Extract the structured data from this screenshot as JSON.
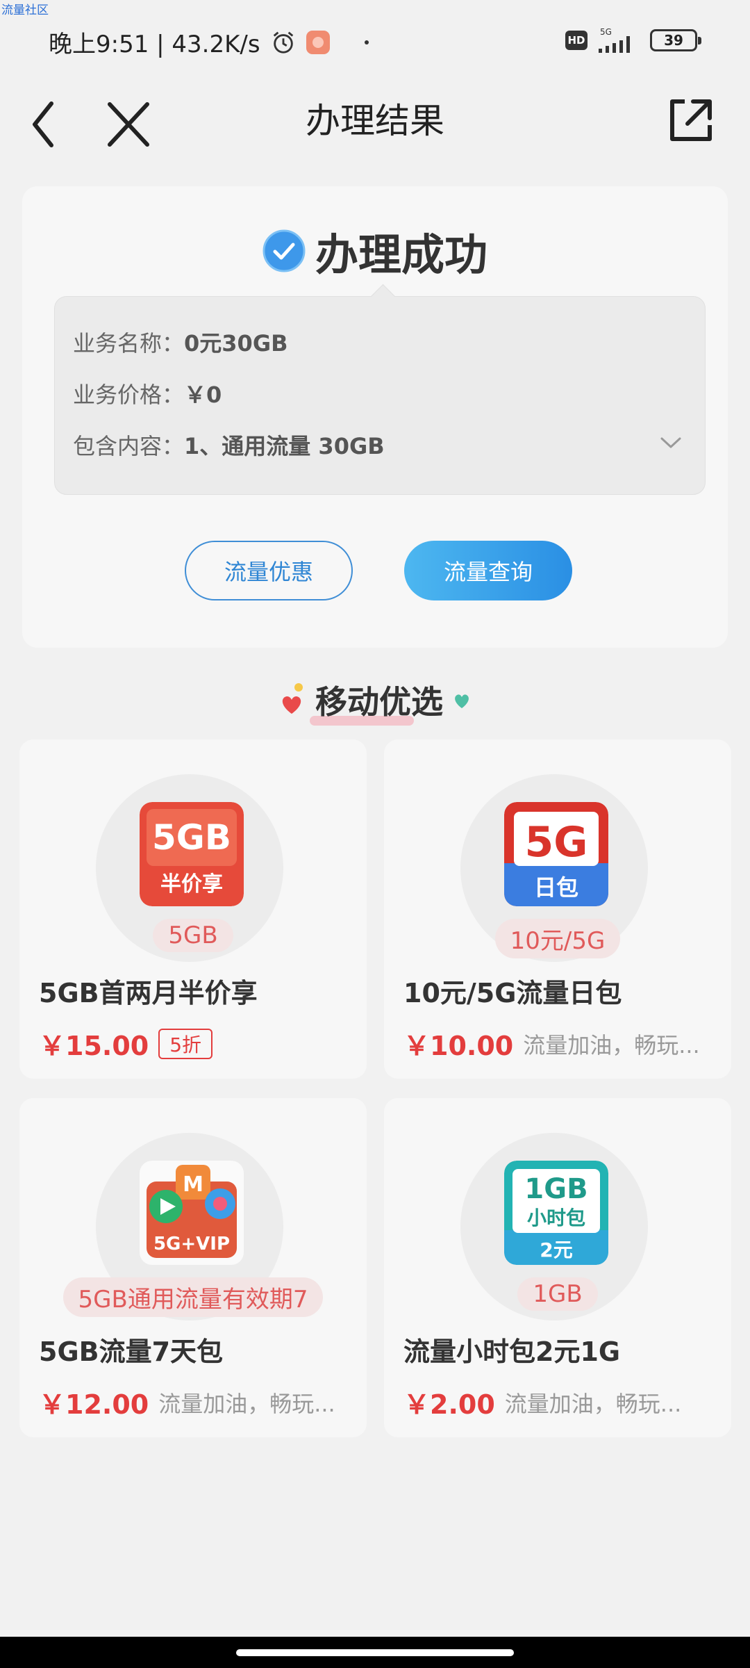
{
  "watermark": "流量社区",
  "status_bar": {
    "left_text": "晚上9:51 | 43.2K/s",
    "battery": "39",
    "hd": "HD",
    "network": "5G"
  },
  "nav": {
    "title": "办理结果"
  },
  "result": {
    "status": "办理成功",
    "details": [
      {
        "label": "业务名称：",
        "value": "0元30GB"
      },
      {
        "label": "业务价格：",
        "value": "￥0"
      },
      {
        "label": "包含内容：",
        "value": "1、通用流量 30GB"
      }
    ],
    "buttons": {
      "offers": "流量优惠",
      "query": "流量查询"
    }
  },
  "section": {
    "title": "移动优选"
  },
  "products": [
    {
      "image_label_top": "5GB",
      "image_label_bottom": "半价享",
      "tag": "5GB",
      "name": "5GB首两月半价享",
      "price": "￥15.00",
      "badge": "5折",
      "colors": {
        "top": "#e64a3a",
        "bottom": "#e64a3a"
      }
    },
    {
      "image_label_top": "5G",
      "image_label_bottom": "日包",
      "tag": "10元/5G",
      "name": "10元/5G流量日包",
      "price": "￥10.00",
      "desc": "流量加油，畅玩...",
      "colors": {
        "top": "#d9342b",
        "bottom": "#3b7de0"
      }
    },
    {
      "image_label_top": "",
      "image_label_bottom": "5G+VIP",
      "tag": "5GB通用流量有效期7",
      "name": "5GB流量7天包",
      "price": "￥12.00",
      "desc": "流量加油，畅玩...",
      "colors": {
        "top": "#e05a3c",
        "bottom": "#e05a3c"
      }
    },
    {
      "image_label_top": "1GB",
      "image_label_mid": "小时包",
      "image_label_bottom": "2元",
      "tag": "1GB",
      "name": "流量小时包2元1G",
      "price": "￥2.00",
      "desc": "流量加油，畅玩...",
      "colors": {
        "top": "#22b3b3",
        "bottom": "#2fa8d8"
      }
    }
  ]
}
